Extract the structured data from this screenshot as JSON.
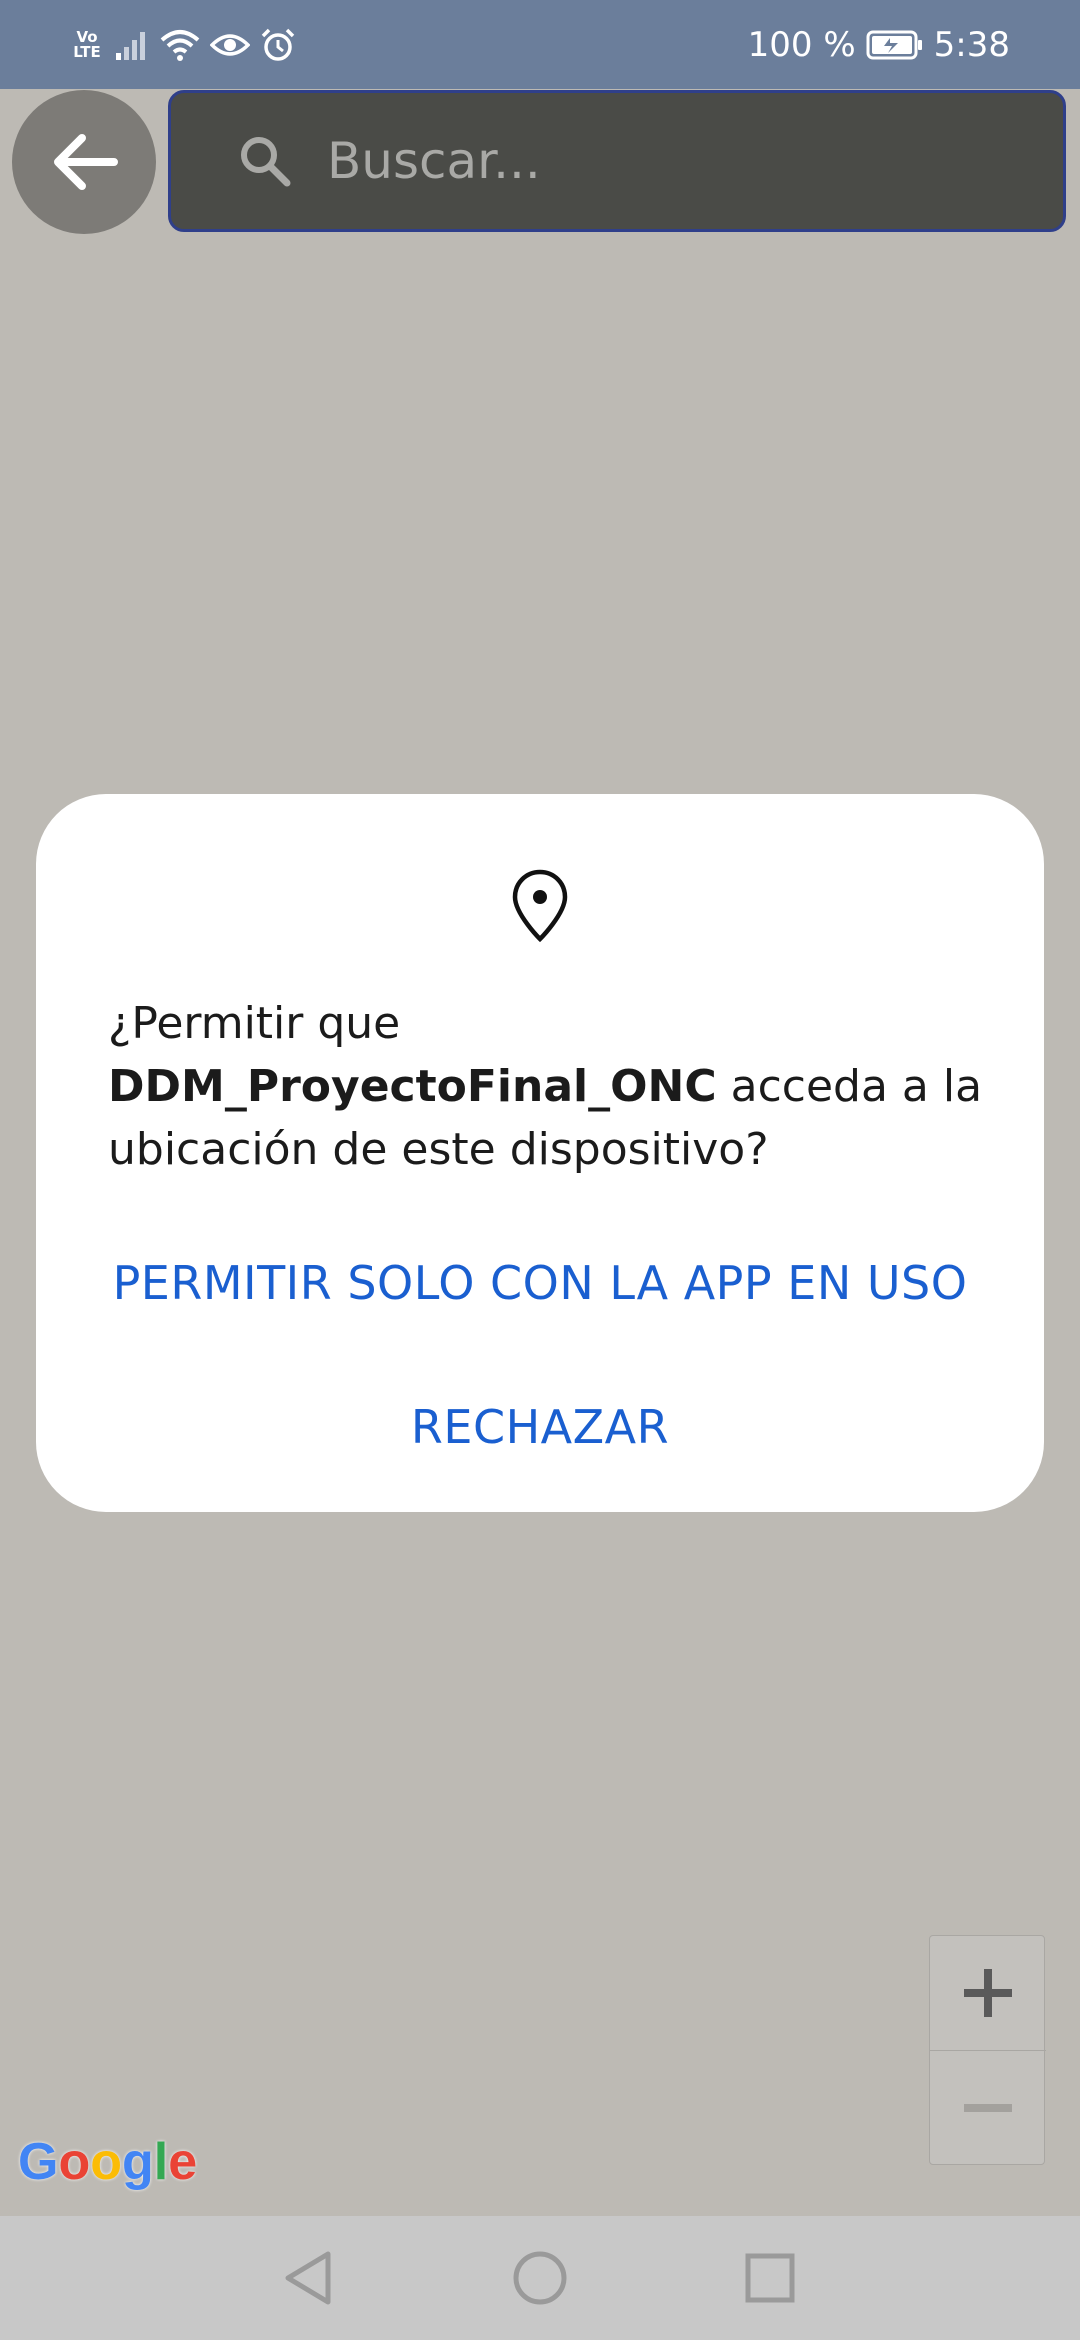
{
  "status_bar": {
    "volte_top": "Vo",
    "volte_bottom": "LTE",
    "battery_percent": "100 %",
    "time": "5:38",
    "icons": [
      "signal-icon",
      "wifi-icon",
      "eye-icon",
      "alarm-icon",
      "battery-charging-icon"
    ]
  },
  "search": {
    "placeholder": "Buscar..."
  },
  "dialog": {
    "prompt_prefix": "¿Permitir que",
    "app_name": "DDM_ProyectoFinal_ONC",
    "prompt_suffix": "acceda a la ubicación de este dispositivo?",
    "allow_label": "PERMITIR SOLO CON LA APP EN USO",
    "deny_label": "RECHAZAR",
    "icon": "location-pin-icon",
    "accent_color": "#1a5fd0"
  },
  "map": {
    "attribution": "Google",
    "zoom_in_icon": "plus-icon",
    "zoom_out_icon": "minus-icon",
    "background_color": "#bdbab4"
  },
  "nav_bar": {
    "icons": [
      "back-triangle-icon",
      "home-circle-icon",
      "recents-square-icon"
    ]
  }
}
